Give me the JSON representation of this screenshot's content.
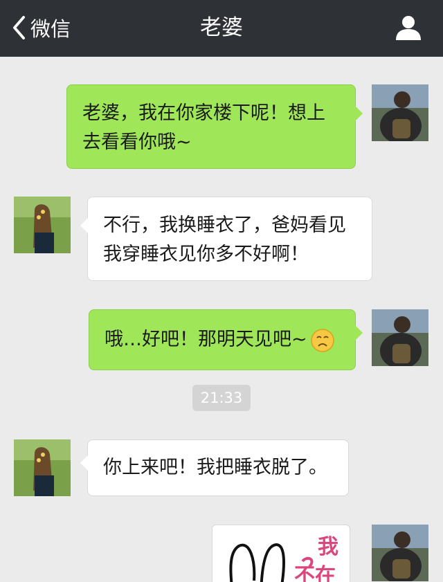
{
  "header": {
    "back_label": "微信",
    "title": "老婆"
  },
  "messages": [
    {
      "side": "right",
      "text_line1": "老婆，我在你家楼下呢！想上",
      "text_line2": "去看看你哦~"
    },
    {
      "side": "left",
      "text_line1": "不行，我换睡衣了，爸妈看见",
      "text_line2": "我穿睡衣见你多不好啊！"
    },
    {
      "side": "right",
      "text": "哦…好吧！那明天见吧~",
      "emoji": "sad-face-icon"
    },
    {
      "side": "left",
      "text": "你上来吧！我把睡衣脱了。"
    }
  ],
  "timestamp": "21:33",
  "sticker": {
    "text_line1": "我",
    "text_line2": "不在"
  },
  "colors": {
    "header_bg": "#2e3135",
    "chat_bg": "#ebebeb",
    "sent_bubble": "#9fe658",
    "received_bubble": "#ffffff"
  }
}
